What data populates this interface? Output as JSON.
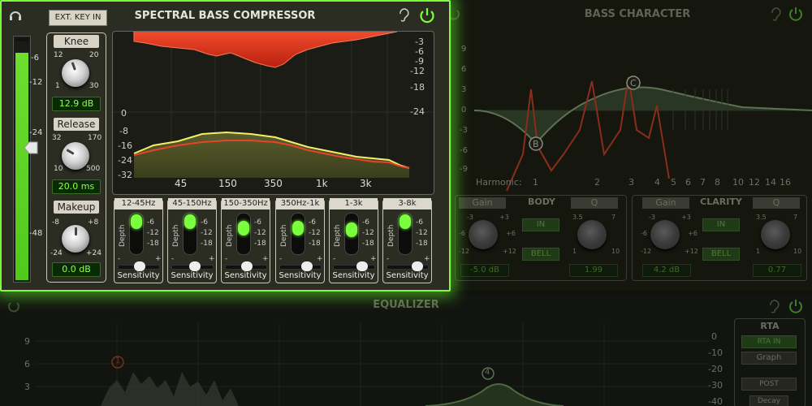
{
  "compressor": {
    "title": "SPECTRAL BASS COMPRESSOR",
    "ext_key_label": "EXT. KEY IN",
    "meter_scale": [
      "-6",
      "-12",
      "-24",
      "-48"
    ],
    "knee": {
      "label": "Knee",
      "ticks": [
        "12",
        "20",
        "1",
        "30"
      ],
      "value": "12.9 dB"
    },
    "release": {
      "label": "Release",
      "ticks": [
        "32",
        "170",
        "10",
        "500"
      ],
      "value": "20.0 ms"
    },
    "makeup": {
      "label": "Makeup",
      "ticks": [
        "-8",
        "+8",
        "-24",
        "+24"
      ],
      "value": "0.0 dB"
    },
    "spectrum": {
      "right_scale": [
        "-3",
        "-6",
        "-9",
        "-12",
        "-18",
        "-24"
      ],
      "left_scale": [
        "0",
        "-8",
        "-16",
        "-24",
        "-32"
      ],
      "freq_labels": [
        "45",
        "150",
        "350",
        "1k",
        "3k"
      ]
    },
    "bands": [
      {
        "label": "12-45Hz",
        "depth": 0.0,
        "sensitivity": 0.55
      },
      {
        "label": "45-150Hz",
        "depth": 0.0,
        "sensitivity": 0.6
      },
      {
        "label": "150-350Hz",
        "depth": 0.3,
        "sensitivity": 0.55
      },
      {
        "label": "350Hz-1k",
        "depth": 0.3,
        "sensitivity": 0.75
      },
      {
        "label": "1-3k",
        "depth": 0.35,
        "sensitivity": 0.8
      },
      {
        "label": "3-8k",
        "depth": 0.0,
        "sensitivity": 0.85
      }
    ],
    "depth_label": "Depth",
    "depth_scale": [
      "-6",
      "-12",
      "-18"
    ],
    "sensitivity_label": "Sensitivity",
    "minus": "-",
    "plus": "+"
  },
  "bass_character": {
    "title": "BASS CHARACTER",
    "y_scale": [
      "9",
      "6",
      "3",
      "0",
      "-3",
      "-6",
      "-9"
    ],
    "harmonic_label": "Harmonic:",
    "harmonics": [
      "1",
      "2",
      "3",
      "4",
      "5",
      "6",
      "7",
      "8",
      "10",
      "12",
      "14",
      "16"
    ],
    "node_b": "B",
    "node_c": "C",
    "body": {
      "title": "BODY",
      "gain_label": "Gain",
      "q_label": "Q",
      "gain_ticks": [
        "-3",
        "+3",
        "-6",
        "+6",
        "-12",
        "+12"
      ],
      "q_ticks": [
        "3.5",
        "7",
        "1",
        "10"
      ],
      "in_label": "IN",
      "bell_label": "BELL",
      "gain_value": "-5.0 dB",
      "q_value": "1.99"
    },
    "clarity": {
      "title": "CLARITY",
      "gain_label": "Gain",
      "q_label": "Q",
      "gain_ticks": [
        "-3",
        "+3",
        "-6",
        "+6",
        "-12",
        "+12"
      ],
      "q_ticks": [
        "3.5",
        "7",
        "1",
        "10"
      ],
      "in_label": "IN",
      "bell_label": "BELL",
      "gain_value": "4.2 dB",
      "q_value": "0.77"
    }
  },
  "equalizer": {
    "title": "EQUALIZER",
    "left_scale": [
      "9",
      "6",
      "3"
    ],
    "right_scale": [
      "0",
      "-10",
      "-20",
      "-30",
      "-40"
    ],
    "node_1": "1",
    "node_4": "4",
    "rta": {
      "title": "RTA",
      "rta_in": "RTA IN",
      "graph": "Graph",
      "post": "POST",
      "decay": "Decay"
    }
  },
  "colors": {
    "accent_green": "#7aff3d",
    "glow": "#6dff2a",
    "orange": "#e8432a",
    "yellow": "#f3ee6a"
  }
}
